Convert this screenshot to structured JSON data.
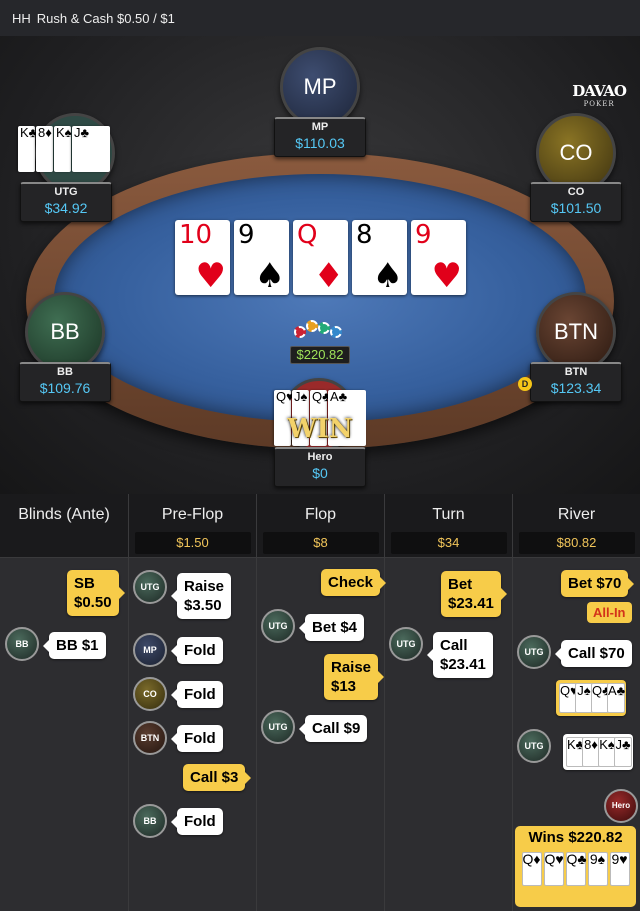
{
  "header": {
    "game_type": "HH",
    "title": "Rush & Cash $0.50 / $1"
  },
  "logo": {
    "brand": "DAVAO",
    "sub": "POKER"
  },
  "table": {
    "pot": "$220.82",
    "board": [
      {
        "rank": "10",
        "suit": "♥",
        "color": "red"
      },
      {
        "rank": "9",
        "suit": "♠",
        "color": "blk"
      },
      {
        "rank": "Q",
        "suit": "♦",
        "color": "red"
      },
      {
        "rank": "8",
        "suit": "♠",
        "color": "blk"
      },
      {
        "rank": "9",
        "suit": "♥",
        "color": "red"
      }
    ],
    "win_label": "WIN",
    "dealer": "D"
  },
  "seats": {
    "mp": {
      "avatar": "MP",
      "name": "MP",
      "stack": "$110.03"
    },
    "utg": {
      "name": "UTG",
      "stack": "$34.92",
      "cards": [
        "K♣",
        "8♦",
        "K♠",
        "J♣"
      ]
    },
    "co": {
      "avatar": "CO",
      "name": "CO",
      "stack": "$101.50"
    },
    "bb": {
      "avatar": "BB",
      "name": "BB",
      "stack": "$109.76"
    },
    "btn": {
      "avatar": "BTN",
      "name": "BTN",
      "stack": "$123.34"
    },
    "hero": {
      "name": "Hero",
      "stack": "$0",
      "cards": [
        "Q♥",
        "J♠",
        "Q♣",
        "A♣"
      ]
    }
  },
  "streets": [
    {
      "name": "Blinds (Ante)",
      "pot": ""
    },
    {
      "name": "Pre-Flop",
      "pot": "$1.50"
    },
    {
      "name": "Flop",
      "pot": "$8"
    },
    {
      "name": "Turn",
      "pot": "$34"
    },
    {
      "name": "River",
      "pot": "$80.82"
    }
  ],
  "actions": {
    "blinds": {
      "sb": "SB\n$0.50",
      "bb_token": "BB",
      "bb": "BB $1"
    },
    "preflop": {
      "utg_token": "UTG",
      "utg": "Raise\n$3.50",
      "mp_token": "MP",
      "mp": "Fold",
      "co_token": "CO",
      "co": "Fold",
      "btn_token": "BTN",
      "btn": "Fold",
      "hero_call": "Call $3",
      "bb_token": "BB",
      "bb": "Fold"
    },
    "flop": {
      "hero_check": "Check",
      "utg_token": "UTG",
      "utg_bet": "Bet $4",
      "hero_raise": "Raise\n$13",
      "utg_token2": "UTG",
      "utg_call": "Call $9"
    },
    "turn": {
      "hero_bet": "Bet\n$23.41",
      "utg_token": "UTG",
      "utg_call": "Call\n$23.41"
    },
    "river": {
      "hero_bet": "Bet $70",
      "allin": "All-In",
      "utg_token": "UTG",
      "utg_call": "Call $70",
      "hero_show": [
        "Q♥",
        "J♠",
        "Q♣",
        "A♣"
      ],
      "utg_token2": "UTG",
      "utg_show": [
        "K♣",
        "8♦",
        "K♠",
        "J♣"
      ],
      "hero_token": "Hero",
      "wins": "Wins $220.82",
      "best_hand": [
        "Q♦",
        "Q♥",
        "Q♣",
        "9♠",
        "9♥"
      ]
    }
  },
  "colors": {
    "accent": "#f7cc49",
    "stack": "#55c8f5",
    "pot": "#9fe35a"
  }
}
